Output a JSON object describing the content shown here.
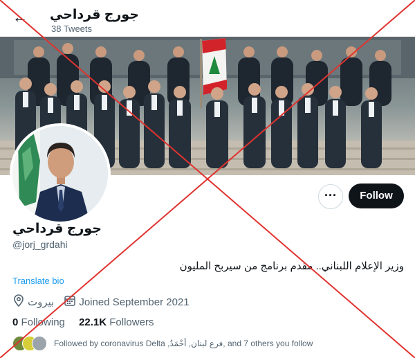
{
  "header": {
    "back_icon": "arrow-left-icon",
    "name": "جورج قرداحي",
    "tweet_count": "38 Tweets"
  },
  "profile": {
    "name": "جورج قرداحي",
    "handle": "@jorj_grdahi",
    "bio": "وزير الإعلام اللبناني.. مقدم برنامج من سيربح المليون",
    "translate_label": "Translate bio",
    "location": "بيروت",
    "joined": "Joined September 2021",
    "following_count": "0",
    "following_label": "Following",
    "followers_count": "22.1K",
    "followers_label": "Followers",
    "followed_by": "Followed by coronavirus Delta ,فرع لبنان, أحْمَدُ, and 7 others you follow"
  },
  "actions": {
    "more_icon": "ellipsis-icon",
    "follow_label": "Follow"
  },
  "colors": {
    "accent": "#1d9bf0",
    "follow_bg": "#0f1419",
    "overlay_cross": "#e0332f"
  }
}
